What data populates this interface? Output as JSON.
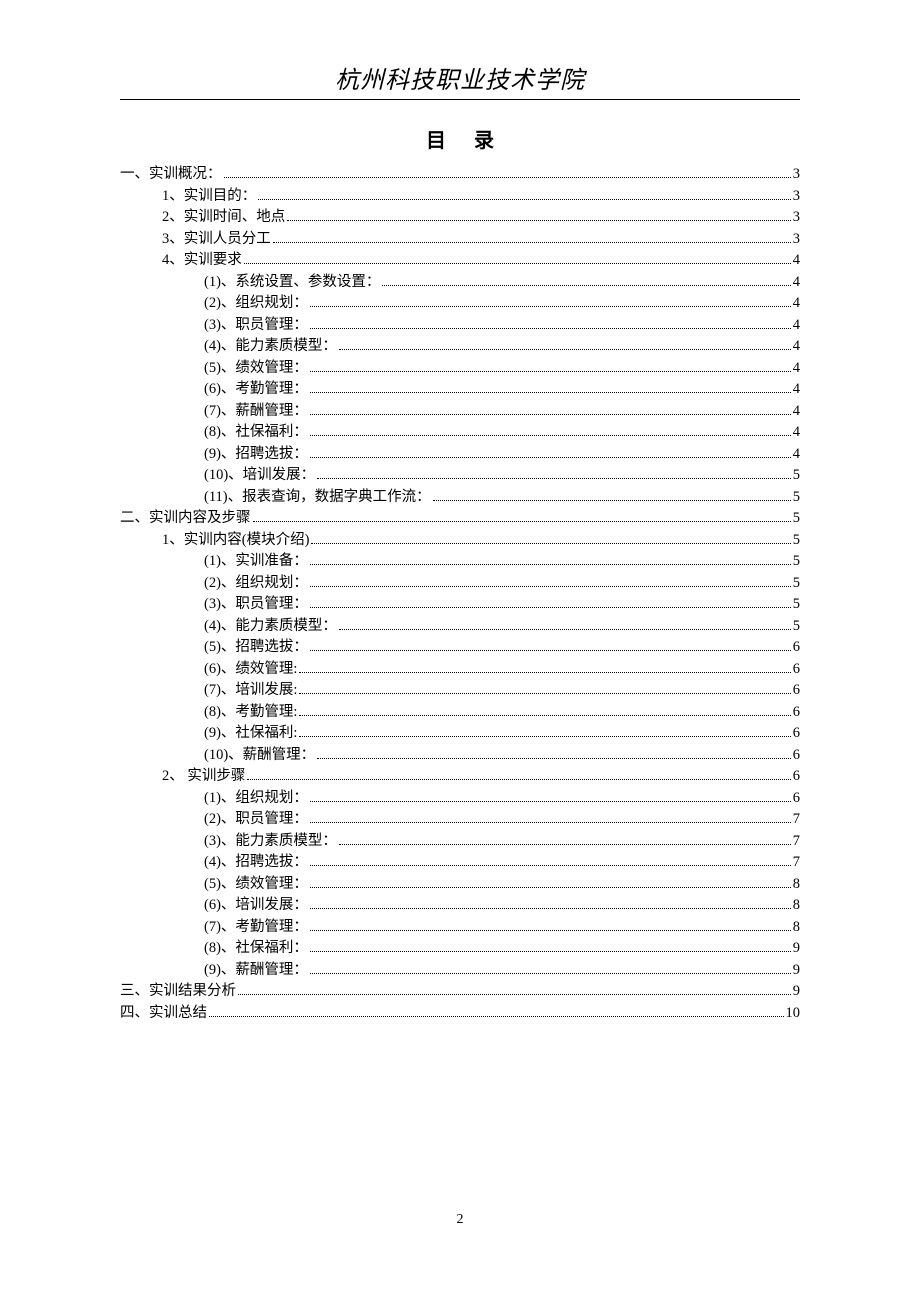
{
  "header": {
    "institution": "杭州科技职业技术学院"
  },
  "toc": {
    "title": "目录",
    "entries": [
      {
        "label": "一、实训概况：",
        "page": "3",
        "indent": 0
      },
      {
        "label": "1、实训目的：",
        "page": "3",
        "indent": 1
      },
      {
        "label": "2、实训时间、地点",
        "page": "3",
        "indent": 1
      },
      {
        "label": "3、实训人员分工",
        "page": "3",
        "indent": 1
      },
      {
        "label": "4、实训要求",
        "page": "4",
        "indent": 1
      },
      {
        "label": "(1)、系统设置、参数设置：",
        "page": "4",
        "indent": 2
      },
      {
        "label": "(2)、组织规划：",
        "page": "4",
        "indent": 2
      },
      {
        "label": "(3)、职员管理：",
        "page": "4",
        "indent": 2
      },
      {
        "label": "(4)、能力素质模型：",
        "page": "4",
        "indent": 2
      },
      {
        "label": "(5)、绩效管理：",
        "page": "4",
        "indent": 2
      },
      {
        "label": "(6)、考勤管理：",
        "page": "4",
        "indent": 2
      },
      {
        "label": "(7)、薪酬管理：",
        "page": "4",
        "indent": 2
      },
      {
        "label": "(8)、社保福利：",
        "page": "4",
        "indent": 2
      },
      {
        "label": "(9)、招聘选拔：",
        "page": "4",
        "indent": 2
      },
      {
        "label": "(10)、培训发展：",
        "page": "5",
        "indent": 2
      },
      {
        "label": "(11)、报表查询，数据字典工作流：",
        "page": "5",
        "indent": 2
      },
      {
        "label": "二、实训内容及步骤",
        "page": "5",
        "indent": 0
      },
      {
        "label": "1、实训内容(模块介绍)",
        "page": "5",
        "indent": 1
      },
      {
        "label": "(1)、实训准备：",
        "page": "5",
        "indent": 2
      },
      {
        "label": "(2)、组织规划：",
        "page": "5",
        "indent": 2
      },
      {
        "label": "(3)、职员管理：",
        "page": "5",
        "indent": 2
      },
      {
        "label": "(4)、能力素质模型：",
        "page": "5",
        "indent": 2
      },
      {
        "label": "(5)、招聘选拔：",
        "page": "6",
        "indent": 2
      },
      {
        "label": "(6)、绩效管理:",
        "page": "6",
        "indent": 2
      },
      {
        "label": "(7)、培训发展:",
        "page": "6",
        "indent": 2
      },
      {
        "label": "(8)、考勤管理:",
        "page": "6",
        "indent": 2
      },
      {
        "label": "(9)、社保福利:",
        "page": "6",
        "indent": 2
      },
      {
        "label": "(10)、薪酬管理：",
        "page": "6",
        "indent": 2
      },
      {
        "label": "2、  实训步骤",
        "page": "6",
        "indent": 1
      },
      {
        "label": "(1)、组织规划：",
        "page": "6",
        "indent": 2
      },
      {
        "label": "(2)、职员管理：",
        "page": "7",
        "indent": 2
      },
      {
        "label": "(3)、能力素质模型：",
        "page": "7",
        "indent": 2
      },
      {
        "label": "(4)、招聘选拔：",
        "page": "7",
        "indent": 2
      },
      {
        "label": "(5)、绩效管理：",
        "page": "8",
        "indent": 2
      },
      {
        "label": "(6)、培训发展：",
        "page": "8",
        "indent": 2
      },
      {
        "label": "(7)、考勤管理：",
        "page": "8",
        "indent": 2
      },
      {
        "label": "(8)、社保福利：",
        "page": "9",
        "indent": 2
      },
      {
        "label": "(9)、薪酬管理：",
        "page": "9",
        "indent": 2
      },
      {
        "label": "三、实训结果分析",
        "page": "9",
        "indent": 0
      },
      {
        "label": "四、实训总结",
        "page": "10",
        "indent": 0
      }
    ]
  },
  "footer": {
    "page_number": "2"
  }
}
